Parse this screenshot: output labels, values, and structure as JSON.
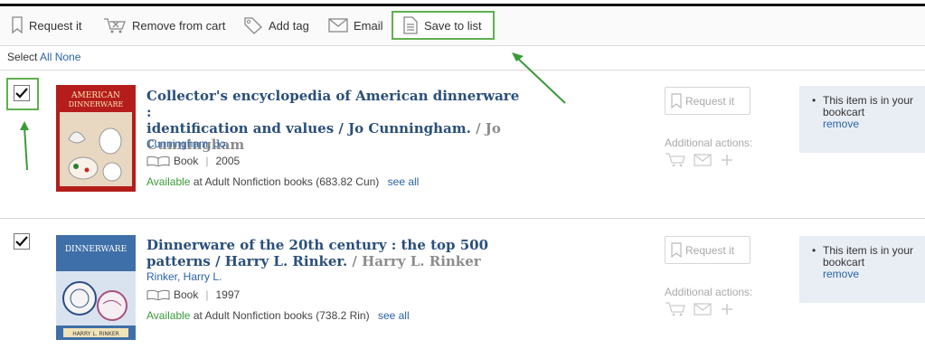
{
  "toolbar": {
    "request_label": "Request it",
    "remove_label": "Remove from cart",
    "tag_label": "Add tag",
    "email_label": "Email",
    "save_label": "Save to list"
  },
  "select": {
    "prefix": "Select",
    "all": "All",
    "none": "None"
  },
  "results": [
    {
      "checked": true,
      "title_line1": "Collector's encyclopedia of American dinnerware :",
      "title_line2": "identification and values / Jo Cunningham.",
      "title_author": "/ Jo",
      "title_line3": "Cunningham",
      "author": "Cunningham, Jo.",
      "format": "Book",
      "year": "2005",
      "avail_status": "Available",
      "avail_text": "at Adult Nonfiction books (683.82 Cun)",
      "see_all": "see all",
      "request_label": "Request it",
      "additional_label": "Additional actions:",
      "cart_text": "This item is in your bookcart",
      "cart_remove": "remove",
      "cover_text_1": "AMERICAN",
      "cover_text_2": "DINNERWARE"
    },
    {
      "checked": true,
      "title_line1": "Dinnerware of the 20th century : the top 500",
      "title_line2": "patterns / Harry L. Rinker.",
      "title_author": "/ Harry L. Rinker",
      "author": "Rinker, Harry L.",
      "format": "Book",
      "year": "1997",
      "avail_status": "Available",
      "avail_text": "at Adult Nonfiction books (738.2 Rin)",
      "see_all": "see all",
      "request_label": "Request it",
      "additional_label": "Additional actions:",
      "cart_text": "This item is in your bookcart",
      "cart_remove": "remove",
      "cover_text_1": "DINNERWARE",
      "cover_text_2": "HARRY L. RINKER"
    }
  ],
  "colors": {
    "link": "#2a63a8",
    "title": "#2b4f7a",
    "available": "#3a9a3a",
    "highlight": "#5fb04e",
    "cartbox": "#e9eef5"
  }
}
